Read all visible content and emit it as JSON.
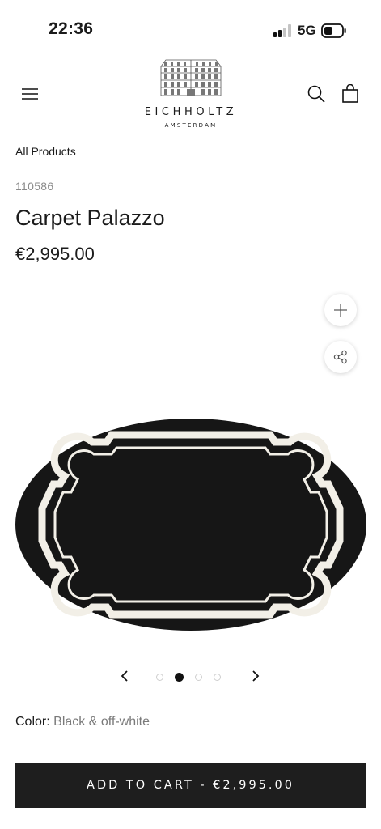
{
  "status_bar": {
    "time": "22:36",
    "network": "5G",
    "signal_bars_filled": 2,
    "signal_bars_total": 4,
    "battery_level": 0.45
  },
  "header": {
    "brand_name": "EICHHOLTZ",
    "brand_location": "AMSTERDAM",
    "icons": [
      "menu-icon",
      "search-icon",
      "shopping-bag-icon"
    ]
  },
  "breadcrumb": "All Products",
  "product": {
    "sku": "110586",
    "title": "Carpet Palazzo",
    "price": "€2,995.00",
    "color_label": "Color:",
    "color_value": "Black & off-white",
    "image_colors": {
      "base": "#161616",
      "border": "#f2efe7"
    }
  },
  "gallery": {
    "current_slide": 2,
    "total_slides": 4,
    "icons": [
      "plus-icon",
      "share-icon",
      "chevron-left-icon",
      "chevron-right-icon"
    ]
  },
  "cta": {
    "add_to_cart_label": "ADD TO CART - €2,995.00"
  }
}
